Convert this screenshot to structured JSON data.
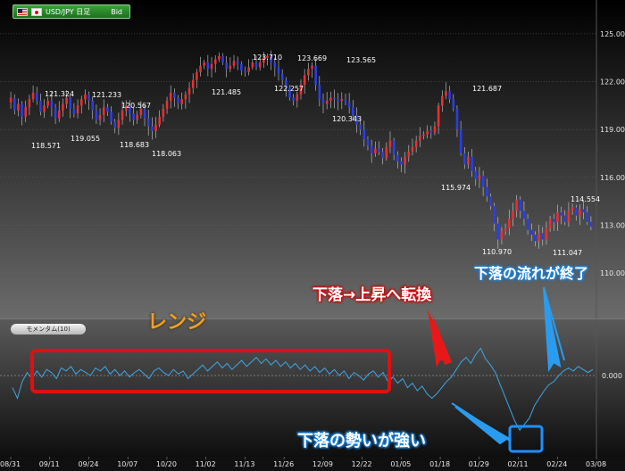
{
  "header": {
    "pair_label": "USD/JPY 日足",
    "quote_type": "Bid",
    "flag_left": "us-flag-icon",
    "flag_right": "jp-flag-icon"
  },
  "indicator": {
    "label": "モメンタム(10)",
    "zero_label": "0.000"
  },
  "callouts": {
    "range": "レンジ",
    "reversal": "下落→上昇へ転換",
    "strong_down": "下落の勢いが強い",
    "downtrend_end": "下落の流れが終了"
  },
  "colors": {
    "up_candle": "#e83030",
    "down_candle": "#2a3ee6",
    "momentum_line": "#3ea6e6",
    "highlight_red": "#e01010",
    "highlight_blue": "#1e90ff",
    "callout_range": "#f0a020",
    "bg_top": "#000000",
    "bg_bottom": "#6b6b6b"
  },
  "chart_data": [
    {
      "type": "candlestick",
      "title": "USD/JPY 日足",
      "ylim": [
        110.0,
        126.0
      ],
      "y_ticks": [
        "125.000",
        "122.000",
        "119.000",
        "116.000",
        "113.000",
        "110.000"
      ],
      "x_tick_labels": [
        "08/31",
        "09/11",
        "09/24",
        "10/07",
        "10/20",
        "11/02",
        "11/13",
        "11/26",
        "12/09",
        "12/22",
        "01/05",
        "01/18",
        "01/29",
        "02/11",
        "02/24",
        "03/08"
      ],
      "grid": true,
      "price_path": [
        121.0,
        120.2,
        120.6,
        119.8,
        120.4,
        120.9,
        121.3,
        120.8,
        120.1,
        120.5,
        120.8,
        120.4,
        119.7,
        120.2,
        120.6,
        121.0,
        120.3,
        120.0,
        120.5,
        120.9,
        121.2,
        120.8,
        120.2,
        119.6,
        119.9,
        120.4,
        120.1,
        119.5,
        119.1,
        119.6,
        120.2,
        120.5,
        120.0,
        119.6,
        119.9,
        120.3,
        119.7,
        119.2,
        118.9,
        119.3,
        119.8,
        120.3,
        120.8,
        121.3,
        121.0,
        120.6,
        120.9,
        121.2,
        121.6,
        122.1,
        122.6,
        123.0,
        123.2,
        122.8,
        123.1,
        123.4,
        123.6,
        123.2,
        122.8,
        123.0,
        123.3,
        123.1,
        122.7,
        122.6,
        122.9,
        123.2,
        122.9,
        123.2,
        123.5,
        123.6,
        123.2,
        122.9,
        122.5,
        122.1,
        121.6,
        121.0,
        120.8,
        121.2,
        121.8,
        122.4,
        122.8,
        123.0,
        121.8,
        120.9,
        120.6,
        120.8,
        121.0,
        120.9,
        120.8,
        120.9,
        120.7,
        120.4,
        119.9,
        119.3,
        119.0,
        118.4,
        118.0,
        117.5,
        117.8,
        117.6,
        117.2,
        117.9,
        118.3,
        117.4,
        117.0,
        116.8,
        117.3,
        117.6,
        117.9,
        118.3,
        118.6,
        118.7,
        118.9,
        118.8,
        119.2,
        120.5,
        121.1,
        121.4,
        120.9,
        120.3,
        119.0,
        117.5,
        116.8,
        117.3,
        116.4,
        115.9,
        116.1,
        115.4,
        114.8,
        114.2,
        113.1,
        112.1,
        112.6,
        112.8,
        113.4,
        113.9,
        114.6,
        113.9,
        113.4,
        112.7,
        112.4,
        112.0,
        112.5,
        112.1,
        112.8,
        113.4,
        113.2,
        113.8,
        113.6,
        113.2,
        113.9,
        114.1,
        113.6,
        114.0,
        113.8,
        113.2,
        112.9
      ],
      "annotations": [
        {
          "text": "118.571"
        },
        {
          "text": "121.324"
        },
        {
          "text": "119.055"
        },
        {
          "text": "121.233"
        },
        {
          "text": "118.683"
        },
        {
          "text": "120.567"
        },
        {
          "text": "118.063"
        },
        {
          "text": "121.485"
        },
        {
          "text": "123.710"
        },
        {
          "text": "122.257"
        },
        {
          "text": "123.669"
        },
        {
          "text": "120.343"
        },
        {
          "text": "123.565"
        },
        {
          "text": "115.974"
        },
        {
          "text": "121.687"
        },
        {
          "text": "110.970"
        },
        {
          "text": "111.047"
        },
        {
          "text": "114.554"
        }
      ]
    },
    {
      "type": "line",
      "title": "モメンタム(10)",
      "series": [
        {
          "name": "モメンタム(10)",
          "values": [
            -0.8,
            -1.5,
            -0.4,
            0.2,
            -0.2,
            0.3,
            -0.1,
            0.4,
            0.2,
            -0.2,
            0.5,
            0.3,
            0.6,
            0.1,
            0.4,
            0.2,
            0.0,
            0.5,
            0.3,
            0.6,
            0.1,
            0.4,
            0.0,
            0.3,
            -0.1,
            0.2,
            0.4,
            0.1,
            -0.2,
            0.3,
            0.5,
            0.2,
            0.0,
            0.4,
            0.1,
            0.3,
            -0.2,
            0.1,
            0.4,
            0.7,
            0.3,
            0.6,
            0.9,
            0.5,
            0.8,
            0.4,
            0.7,
            1.0,
            0.6,
            0.9,
            1.2,
            0.8,
            1.1,
            0.7,
            1.0,
            0.6,
            0.9,
            0.5,
            0.8,
            0.4,
            0.7,
            0.3,
            0.6,
            0.2,
            0.5,
            0.1,
            0.4,
            0.0,
            0.3,
            -0.2,
            0.2,
            0.0,
            -0.3,
            0.1,
            0.3,
            -0.1,
            0.2,
            -0.4,
            -0.1,
            -0.5,
            -0.2,
            -0.8,
            -0.5,
            -1.0,
            -0.7,
            -1.2,
            -1.5,
            -1.2,
            -0.8,
            -0.4,
            -0.1,
            0.4,
            0.9,
            1.2,
            0.8,
            1.4,
            1.8,
            1.1,
            0.7,
            0.2,
            -0.6,
            -1.4,
            -2.2,
            -3.0,
            -3.6,
            -3.2,
            -2.8,
            -2.0,
            -1.5,
            -1.0,
            -0.6,
            -0.4,
            0.0,
            0.3,
            0.5,
            0.3,
            0.6,
            0.4,
            0.2,
            0.4
          ]
        }
      ],
      "zero_line": 0.0
    }
  ]
}
